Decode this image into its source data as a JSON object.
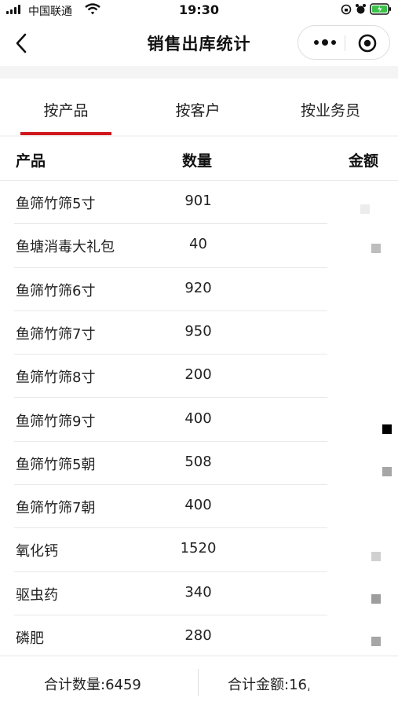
{
  "status_bar": {
    "carrier": "中国联通",
    "time": "19:30"
  },
  "nav": {
    "title": "销售出库统计"
  },
  "tabs": [
    {
      "label": "按产品",
      "active": true
    },
    {
      "label": "按客户",
      "active": false
    },
    {
      "label": "按业务员",
      "active": false
    }
  ],
  "table": {
    "headers": {
      "product": "产品",
      "quantity": "数量",
      "amount": "金额"
    },
    "rows": [
      {
        "product": "鱼筛竹筛5寸",
        "quantity": "901"
      },
      {
        "product": "鱼塘消毒大礼包",
        "quantity": "40"
      },
      {
        "product": "鱼筛竹筛6寸",
        "quantity": "920"
      },
      {
        "product": "鱼筛竹筛7寸",
        "quantity": "950"
      },
      {
        "product": "鱼筛竹筛8寸",
        "quantity": "200"
      },
      {
        "product": "鱼筛竹筛9寸",
        "quantity": "400"
      },
      {
        "product": "鱼筛竹筛5朝",
        "quantity": "508"
      },
      {
        "product": "鱼筛竹筛7朝",
        "quantity": "400"
      },
      {
        "product": "氧化钙",
        "quantity": "1520"
      },
      {
        "product": "驱虫药",
        "quantity": "340"
      },
      {
        "product": "磷肥",
        "quantity": "280"
      }
    ]
  },
  "footer": {
    "total_quantity": "合计数量:6459",
    "total_amount": "合计金额:16,"
  },
  "colors": {
    "accent": "#d0171e",
    "divider": "#e8e8e8",
    "page_bg": "#f4f4f4"
  }
}
